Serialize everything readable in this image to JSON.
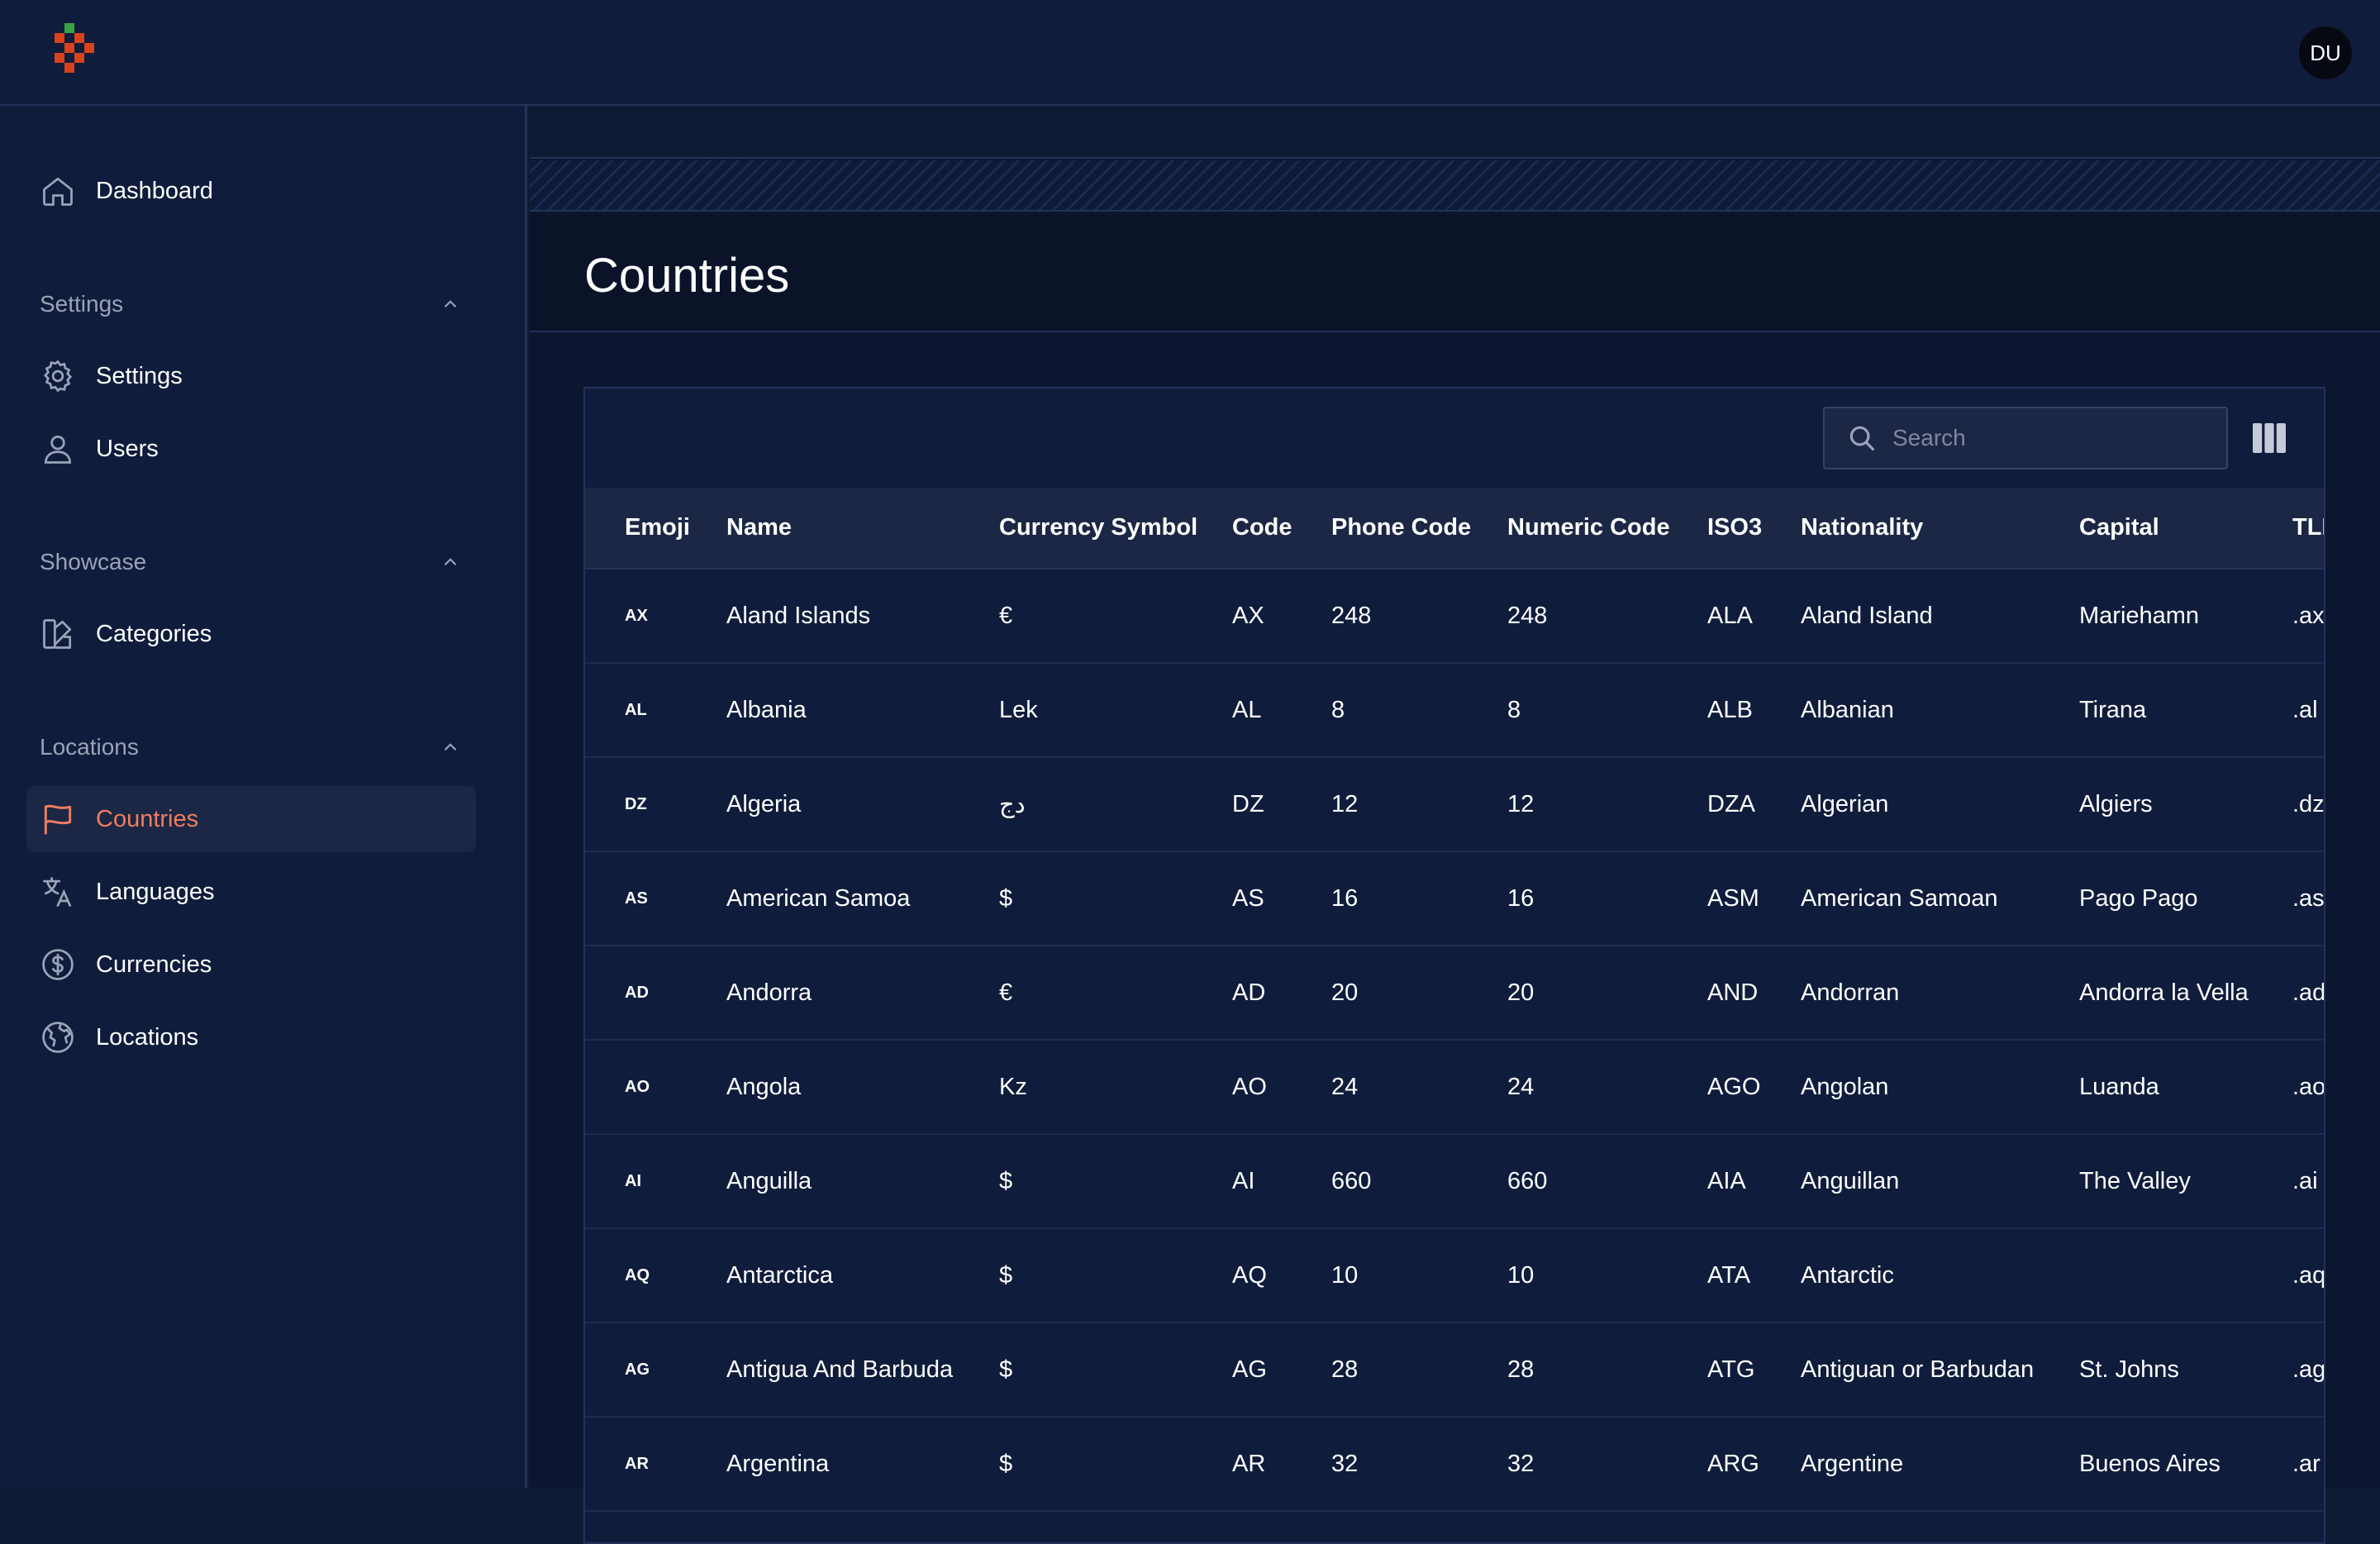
{
  "header": {
    "avatar_initials": "DU"
  },
  "sidebar": {
    "dashboard": "Dashboard",
    "sections": [
      {
        "title": "Settings",
        "items": [
          "Settings",
          "Users"
        ]
      },
      {
        "title": "Showcase",
        "items": [
          "Categories"
        ]
      },
      {
        "title": "Locations",
        "items": [
          "Countries",
          "Languages",
          "Currencies",
          "Locations"
        ]
      }
    ],
    "active_item": "Countries"
  },
  "page": {
    "title": "Countries"
  },
  "table": {
    "search_placeholder": "Search",
    "columns": [
      "Emoji",
      "Name",
      "Currency Symbol",
      "Code",
      "Phone Code",
      "Numeric Code",
      "ISO3",
      "Nationality",
      "Capital",
      "TLD"
    ],
    "rows": [
      [
        "AX",
        "Aland Islands",
        "€",
        "AX",
        "248",
        "248",
        "ALA",
        "Aland Island",
        "Mariehamn",
        ".ax"
      ],
      [
        "AL",
        "Albania",
        "Lek",
        "AL",
        "8",
        "8",
        "ALB",
        "Albanian",
        "Tirana",
        ".al"
      ],
      [
        "DZ",
        "Algeria",
        "دج",
        "DZ",
        "12",
        "12",
        "DZA",
        "Algerian",
        "Algiers",
        ".dz"
      ],
      [
        "AS",
        "American Samoa",
        "$",
        "AS",
        "16",
        "16",
        "ASM",
        "American Samoan",
        "Pago Pago",
        ".as"
      ],
      [
        "AD",
        "Andorra",
        "€",
        "AD",
        "20",
        "20",
        "AND",
        "Andorran",
        "Andorra la Vella",
        ".ad"
      ],
      [
        "AO",
        "Angola",
        "Kz",
        "AO",
        "24",
        "24",
        "AGO",
        "Angolan",
        "Luanda",
        ".ao"
      ],
      [
        "AI",
        "Anguilla",
        "$",
        "AI",
        "660",
        "660",
        "AIA",
        "Anguillan",
        "The Valley",
        ".ai"
      ],
      [
        "AQ",
        "Antarctica",
        "$",
        "AQ",
        "10",
        "10",
        "ATA",
        "Antarctic",
        "",
        ".aq"
      ],
      [
        "AG",
        "Antigua And Barbuda",
        "$",
        "AG",
        "28",
        "28",
        "ATG",
        "Antiguan or Barbudan",
        "St. Johns",
        ".ag"
      ],
      [
        "AR",
        "Argentina",
        "$",
        "AR",
        "32",
        "32",
        "ARG",
        "Argentine",
        "Buenos Aires",
        ".ar"
      ]
    ]
  },
  "colors": {
    "background": "#0f1a35",
    "accent": "#ef7d60",
    "border": "#23325a",
    "logo_green": "#3aa245",
    "logo_red": "#d8431c"
  }
}
